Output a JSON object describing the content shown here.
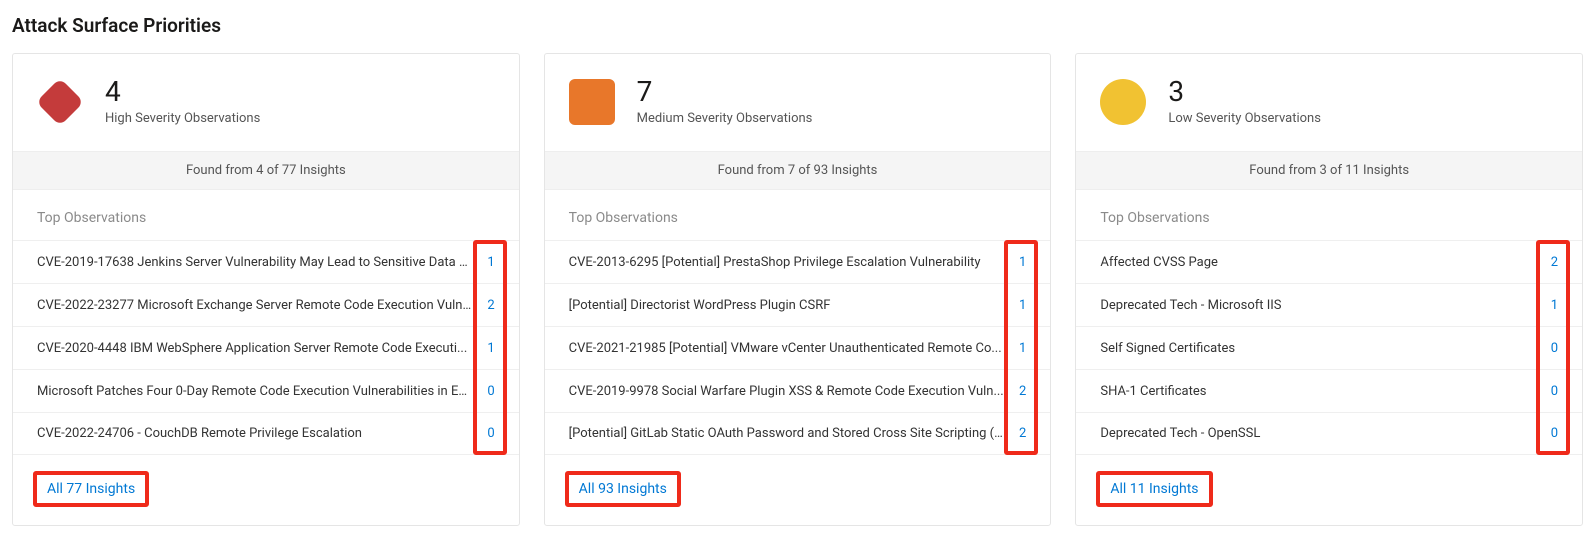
{
  "page_title": "Attack Surface Priorities",
  "cards": [
    {
      "severity": "high",
      "count": "4",
      "label": "High Severity Observations",
      "found_text": "Found from 4 of 77 Insights",
      "top_title": "Top Observations",
      "all_link": "All 77 Insights",
      "items": [
        {
          "name": "CVE-2019-17638 Jenkins Server Vulnerability May Lead to Sensitive Data L...",
          "count": "1"
        },
        {
          "name": "CVE-2022-23277 Microsoft Exchange Server Remote Code Execution Vuln...",
          "count": "2"
        },
        {
          "name": "CVE-2020-4448 IBM WebSphere Application Server Remote Code Executi...",
          "count": "1"
        },
        {
          "name": "Microsoft Patches Four 0-Day Remote Code Execution Vulnerabilities in Ex...",
          "count": "0"
        },
        {
          "name": "CVE-2022-24706 - CouchDB Remote Privilege Escalation",
          "count": "0"
        }
      ]
    },
    {
      "severity": "medium",
      "count": "7",
      "label": "Medium Severity Observations",
      "found_text": "Found from 7 of 93 Insights",
      "top_title": "Top Observations",
      "all_link": "All 93 Insights",
      "items": [
        {
          "name": "CVE-2013-6295 [Potential] PrestaShop Privilege Escalation Vulnerability",
          "count": "1"
        },
        {
          "name": "[Potential] Directorist WordPress Plugin CSRF",
          "count": "1"
        },
        {
          "name": "CVE-2021-21985 [Potential] VMware vCenter Unauthenticated Remote Co...",
          "count": "1"
        },
        {
          "name": "CVE-2019-9978 Social Warfare Plugin XSS & Remote Code Execution Vuln...",
          "count": "2"
        },
        {
          "name": "[Potential] GitLab Static OAuth Password and Stored Cross Site Scripting (X...",
          "count": "2"
        }
      ]
    },
    {
      "severity": "low",
      "count": "3",
      "label": "Low Severity Observations",
      "found_text": "Found from 3 of 11 Insights",
      "top_title": "Top Observations",
      "all_link": "All 11 Insights",
      "items": [
        {
          "name": "Affected CVSS Page",
          "count": "2"
        },
        {
          "name": "Deprecated Tech - Microsoft IIS",
          "count": "1"
        },
        {
          "name": "Self Signed Certificates",
          "count": "0"
        },
        {
          "name": "SHA-1 Certificates",
          "count": "0"
        },
        {
          "name": "Deprecated Tech - OpenSSL",
          "count": "0"
        }
      ]
    }
  ]
}
